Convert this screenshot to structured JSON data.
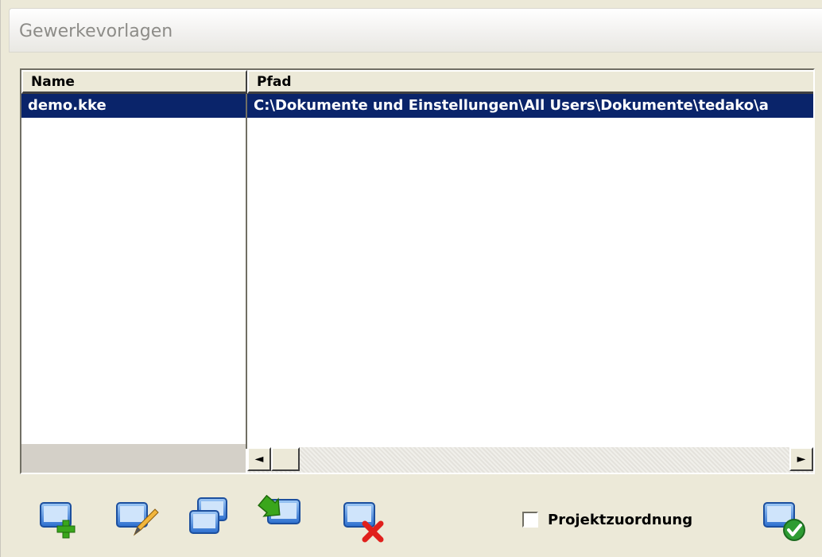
{
  "window": {
    "title": "Gewerkevorlagen"
  },
  "table": {
    "columns": [
      "Name",
      "Pfad"
    ],
    "rows": [
      {
        "name": "demo.kke",
        "path": "C:\\Dokumente und Einstellungen\\All Users\\Dokumente\\tedako\\a"
      }
    ],
    "selected_row": 0
  },
  "scrollbar": {
    "left_arrow": "◄",
    "right_arrow": "►"
  },
  "toolbar": {
    "buttons": [
      {
        "icon": "add-template-icon"
      },
      {
        "icon": "edit-template-icon"
      },
      {
        "icon": "copy-template-icon"
      },
      {
        "icon": "import-template-icon"
      },
      {
        "icon": "delete-template-icon"
      },
      {
        "icon": "confirm-icon"
      }
    ],
    "checkbox_label": "Projektzuordnung",
    "checkbox_checked": false
  },
  "colors": {
    "selection": "#0a246a",
    "add": "#3aa61c",
    "delete": "#e0201c",
    "confirm": "#2e9c33"
  }
}
